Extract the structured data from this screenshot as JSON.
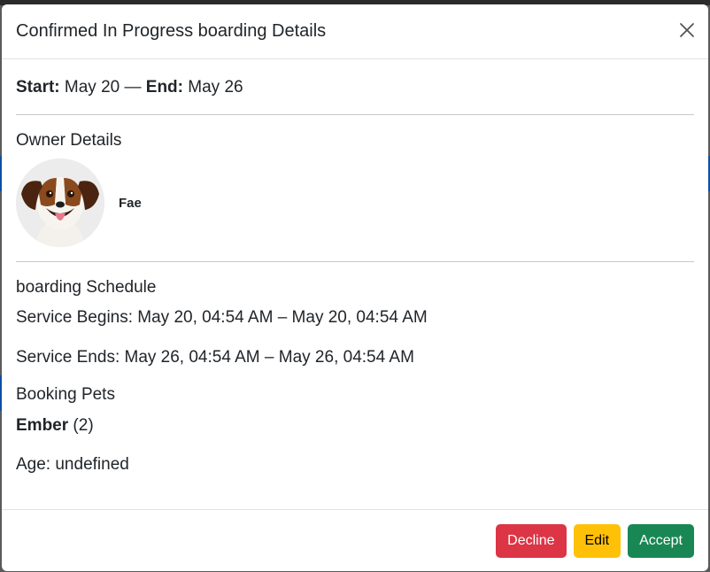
{
  "modal": {
    "title": "Confirmed In Progress boarding Details"
  },
  "dates": {
    "start_label": "Start:",
    "start_value": "May 20",
    "separator": "—",
    "end_label": "End:",
    "end_value": "May 26"
  },
  "owner": {
    "section_title": "Owner Details",
    "name": "Fae",
    "avatar_icon": "dog-avatar"
  },
  "schedule": {
    "section_title": "boarding Schedule",
    "begins": "Service Begins: May 20, 04:54 AM – May 20, 04:54 AM",
    "ends": "Service Ends: May 26, 04:54 AM – May 26, 04:54 AM"
  },
  "pets": {
    "section_title": "Booking Pets",
    "name": "Ember",
    "count": "(2)",
    "age": "Age: undefined"
  },
  "footer": {
    "decline_label": "Decline",
    "edit_label": "Edit",
    "accept_label": "Accept"
  },
  "colors": {
    "decline": "#dc3545",
    "edit": "#ffc107",
    "accept": "#198754"
  }
}
